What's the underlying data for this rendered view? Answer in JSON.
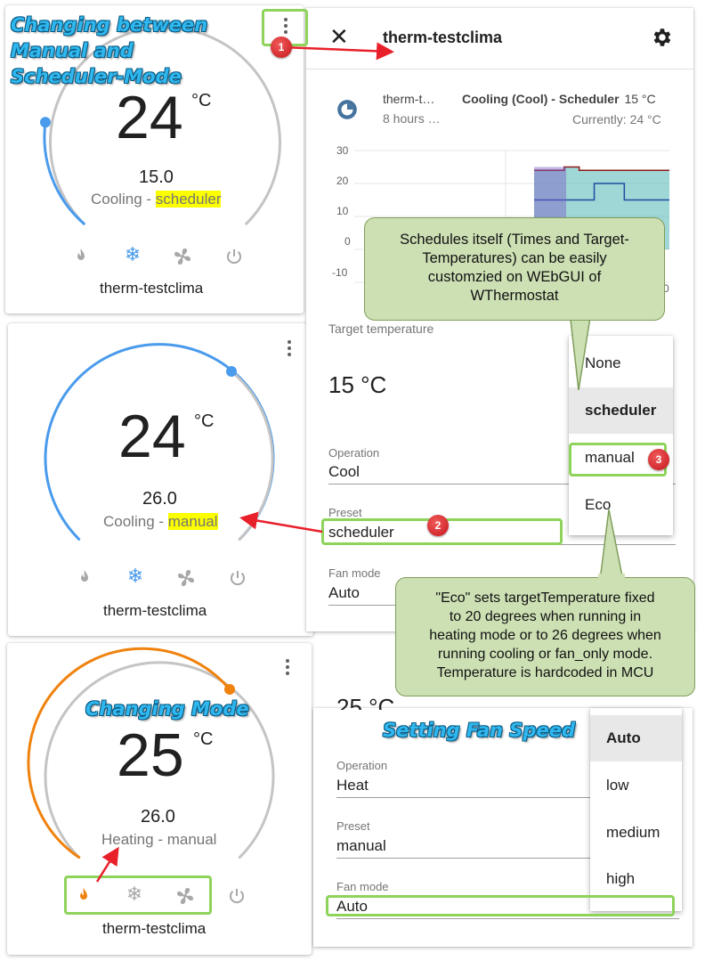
{
  "annotations": {
    "title_manual_scheduler": [
      "Changing between",
      "Manual and",
      "Scheduler-Mode"
    ],
    "title_changing_mode": "Changing Mode",
    "title_fan_speed": "Setting Fan Speed",
    "badge_1": "1",
    "badge_2": "2",
    "badge_3": "3",
    "bubble_schedules": [
      "Schedules itself (Times and Target-",
      "Temperatures) can be easily",
      "customzied on WEbGUI of",
      "WThermostat"
    ],
    "bubble_eco": [
      "\"Eco\" sets targetTemperature fixed",
      "to 20 degrees when running in",
      "heating mode or to 26 degrees when",
      "running cooling or fan_only mode.",
      "Temperature is hardcoded in MCU"
    ]
  },
  "cards": [
    {
      "temp": "24",
      "unit": "°C",
      "setpoint": "15.0",
      "mode_text": "Cooling - ",
      "preset_text": "scheduler",
      "name": "therm-testclima",
      "active_mode": "cool",
      "arc_color": "#4a9bec"
    },
    {
      "temp": "24",
      "unit": "°C",
      "setpoint": "26.0",
      "mode_text": "Cooling - ",
      "preset_text": "manual",
      "name": "therm-testclima",
      "active_mode": "cool",
      "arc_color": "#4a9bec"
    },
    {
      "temp": "25",
      "unit": "°C",
      "setpoint": "26.0",
      "mode_text": "Heating - manual",
      "name": "therm-testclima",
      "active_mode": "heat",
      "arc_color": "#f0820e"
    }
  ],
  "dialog": {
    "close_icon": "close-icon",
    "title": "therm-testclima",
    "settings_icon": "gear-icon",
    "history_entity": "therm-t…",
    "history_time": "8 hours …",
    "history_state": "Cooling (Cool) - Scheduler",
    "history_target": "15 °C",
    "history_current": "Currently: 24 °C",
    "target_label": "Target temperature",
    "target_value": "15 °C",
    "operation_label": "Operation",
    "operation_value": "Cool",
    "preset_label": "Preset",
    "preset_value": "scheduler",
    "fan_label": "Fan mode",
    "fan_value": "Auto",
    "preset_options": [
      "None",
      "scheduler",
      "manual",
      "Eco"
    ],
    "preset_selected": "scheduler",
    "chart_axis_cut": "0"
  },
  "dialog2": {
    "partial_top": "25 °C",
    "operation_label": "Operation",
    "operation_value": "Heat",
    "preset_label": "Preset",
    "preset_value": "manual",
    "fan_label": "Fan mode",
    "fan_value": "Auto",
    "fan_options": [
      "Auto",
      "low",
      "medium",
      "high"
    ],
    "fan_selected": "Auto"
  },
  "colors": {
    "cool": "#4a9bec",
    "heat": "#f0820e",
    "annotation_green": "#8ed35a",
    "highlight": "#fbff00",
    "badge": "#d42a2a"
  },
  "chart_data": {
    "type": "area",
    "yticks": [
      "30",
      "20",
      "10",
      "0",
      "-10"
    ],
    "ylim": [
      -10,
      30
    ],
    "series": [
      {
        "name": "",
        "values": [
          24,
          24,
          25,
          24,
          24,
          24,
          24,
          24,
          24,
          24
        ]
      },
      {
        "name": "",
        "values": [
          15,
          15,
          15,
          15,
          20,
          20,
          15,
          15,
          15,
          15
        ]
      }
    ]
  }
}
